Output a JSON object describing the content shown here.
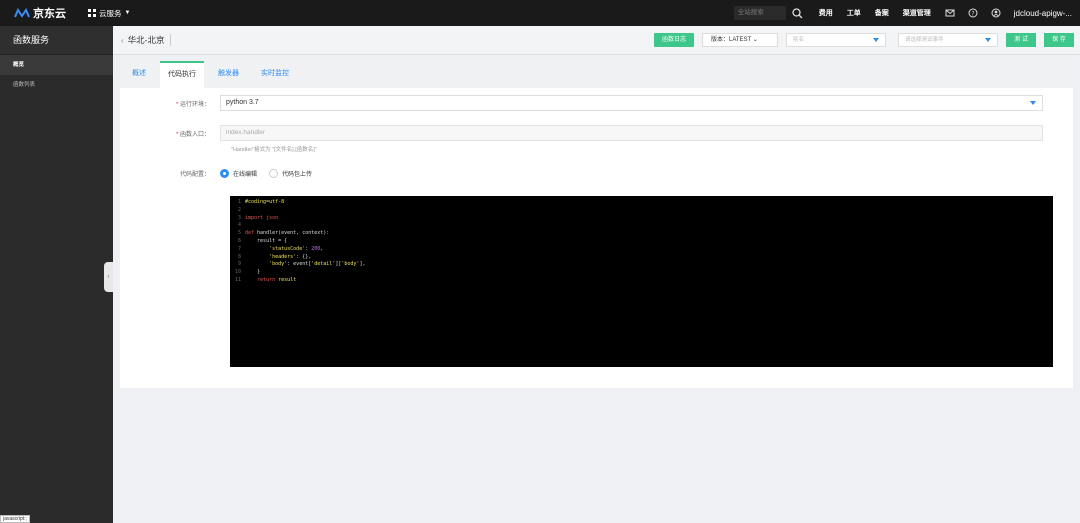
{
  "topbar": {
    "logo_text": "京东云",
    "cloud_menu_label": "云服务",
    "search_placeholder": "全站搜索",
    "links": [
      "费用",
      "工单",
      "备案",
      "渠道管理"
    ],
    "user": "jdcloud-apigw-..."
  },
  "sidebar": {
    "title": "函数服务",
    "items": [
      "概览",
      "函数列表"
    ],
    "status_tip": "javascript:;"
  },
  "header": {
    "region": "华北-北京",
    "log_button": "函数日志",
    "version_label": "版本：LATEST",
    "alias_placeholder": "别名",
    "test_event_placeholder": "请选择测试事件",
    "test_button": "测 试",
    "save_button": "保 存"
  },
  "tabs": [
    "概述",
    "代码执行",
    "触发器",
    "实时监控"
  ],
  "form": {
    "runtime_label": "运行环境：",
    "runtime_value": "python 3.7",
    "entry_label": "函数入口：",
    "entry_value": "index.handler",
    "entry_hint": "\"Handler\"格式为 \"[文件名].[函数名]\"",
    "code_config_label": "代码配置：",
    "radio_online": "在线编辑",
    "radio_upload": "代码包上传"
  },
  "editor": {
    "lines": [
      {
        "n": "1",
        "parts": [
          {
            "t": "#coding=utf-8",
            "c": "c-comment"
          }
        ]
      },
      {
        "n": "2",
        "parts": []
      },
      {
        "n": "3",
        "parts": [
          {
            "t": "import",
            "c": "c-kw"
          },
          {
            "t": " json",
            "c": "c-kw"
          }
        ]
      },
      {
        "n": "4",
        "parts": []
      },
      {
        "n": "5",
        "parts": [
          {
            "t": "def",
            "c": "c-kw"
          },
          {
            "t": " handler(event, context):",
            "c": "c-fn"
          }
        ]
      },
      {
        "n": "6",
        "parts": [
          {
            "t": "    result = {",
            "c": "c-fn"
          }
        ]
      },
      {
        "n": "7",
        "parts": [
          {
            "t": "        ",
            "c": "c-fn"
          },
          {
            "t": "'statusCode'",
            "c": "c-str"
          },
          {
            "t": ": ",
            "c": "c-fn"
          },
          {
            "t": "200",
            "c": "c-num"
          },
          {
            "t": ",",
            "c": "c-fn"
          }
        ]
      },
      {
        "n": "8",
        "parts": [
          {
            "t": "        ",
            "c": "c-fn"
          },
          {
            "t": "'headers'",
            "c": "c-str"
          },
          {
            "t": ": {},",
            "c": "c-fn"
          }
        ]
      },
      {
        "n": "9",
        "parts": [
          {
            "t": "        ",
            "c": "c-fn"
          },
          {
            "t": "'body'",
            "c": "c-str"
          },
          {
            "t": ": event[",
            "c": "c-fn"
          },
          {
            "t": "'detail'",
            "c": "c-str"
          },
          {
            "t": "][",
            "c": "c-fn"
          },
          {
            "t": "'body'",
            "c": "c-str"
          },
          {
            "t": "],",
            "c": "c-fn"
          }
        ]
      },
      {
        "n": "10",
        "parts": [
          {
            "t": "    }",
            "c": "c-fn"
          }
        ]
      },
      {
        "n": "11",
        "parts": [
          {
            "t": "    ",
            "c": "c-fn"
          },
          {
            "t": "return",
            "c": "c-kw"
          },
          {
            "t": " result",
            "c": "c-str"
          }
        ]
      }
    ]
  },
  "colors": {
    "accent_green": "#3ec78a",
    "link_blue": "#2f8cf2",
    "topbar_bg": "#1a1a1a",
    "sidebar_bg": "#2b2b2b"
  }
}
